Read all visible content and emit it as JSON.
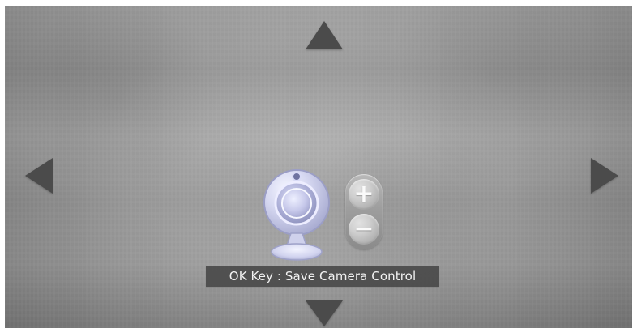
{
  "overlay": {
    "instruction": "OK Key : Save Camera Control"
  },
  "controls": {
    "zoom_in_symbol": "+",
    "zoom_out_symbol": "−"
  },
  "icons": {
    "pan_up": "up-arrow-icon",
    "pan_down": "down-arrow-icon",
    "pan_left": "left-arrow-icon",
    "pan_right": "right-arrow-icon",
    "camera": "camera-icon",
    "zoom_in": "plus-icon",
    "zoom_out": "minus-icon"
  },
  "colors": {
    "arrow": "#4b4b4b",
    "status_bar": "#484848",
    "camera_fill": "#c8cae8",
    "camera_border": "#8f92b7"
  }
}
